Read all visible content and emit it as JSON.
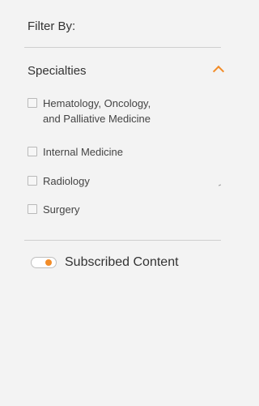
{
  "filter": {
    "title": "Filter By:"
  },
  "specialties": {
    "title": "Specialties",
    "items": [
      {
        "label": "Hematology, Oncology,\nand Palliative Medicine",
        "checked": false
      },
      {
        "label": "Internal Medicine",
        "checked": false
      },
      {
        "label": "Radiology",
        "checked": false
      },
      {
        "label": "Surgery",
        "checked": false
      }
    ]
  },
  "subscribed": {
    "label": "Subscribed Content",
    "on": true
  },
  "colors": {
    "accent": "#f28c28",
    "background": "#f3f3f3",
    "divider": "#cfcfcf"
  },
  "icons": {
    "collapse": "chevron-up-icon"
  }
}
